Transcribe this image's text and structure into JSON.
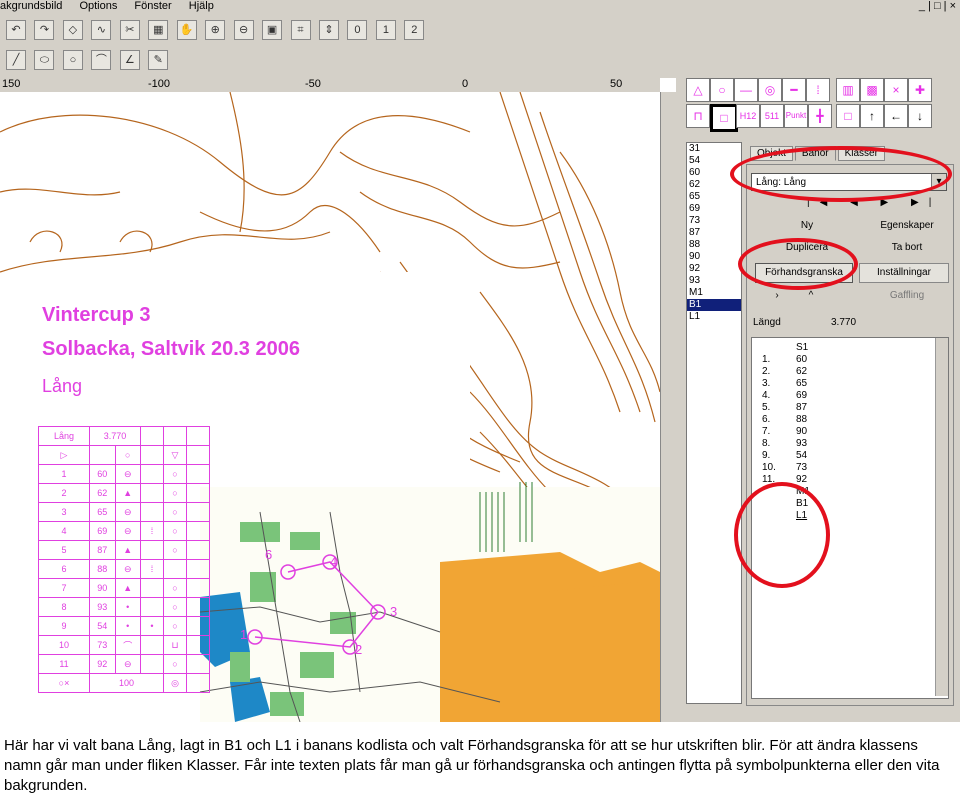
{
  "menu": {
    "items": [
      "akgrundsbild",
      "Options",
      "Fönster",
      "Hjälp"
    ],
    "window_controls": "_ | □ | ×"
  },
  "toolbar": {
    "row1_icons": [
      "undo-icon",
      "redo-icon",
      "diamond-icon",
      "curve-icon",
      "scissors-icon",
      "grid-icon",
      "hand-icon",
      "zoom-in-icon",
      "zoom-out-icon",
      "zoom-box-icon",
      "crosshair-icon",
      "move-icon"
    ],
    "row1_labels": [
      "0",
      "1",
      "2"
    ],
    "row2_icons": [
      "line-icon",
      "ellipse-icon",
      "circle-icon",
      "arc-icon",
      "angle-icon",
      "pen-icon"
    ]
  },
  "ruler": {
    "labels": [
      "150",
      "-100",
      "-50",
      "0",
      "50"
    ]
  },
  "map": {
    "title_line1": "Vintercup 3",
    "title_line2": "Solbacka, Saltvik 20.3 2006",
    "course": "Lång",
    "legend_header": [
      "Lång",
      "3.770"
    ],
    "legend_rows": [
      [
        "1",
        "60"
      ],
      [
        "2",
        "62"
      ],
      [
        "3",
        "65"
      ],
      [
        "4",
        "69"
      ],
      [
        "5",
        "87"
      ],
      [
        "6",
        "88"
      ],
      [
        "7",
        "90"
      ],
      [
        "8",
        "93"
      ],
      [
        "9",
        "54"
      ],
      [
        "10",
        "73"
      ],
      [
        "11",
        "92"
      ]
    ],
    "legend_footer": "100",
    "map_labels": [
      "6",
      "4",
      "3",
      "2",
      "1"
    ]
  },
  "symbols": {
    "row1": [
      "△",
      "○",
      "—",
      "◎",
      "━",
      "⁞",
      "▥",
      "▩",
      "×",
      "✚"
    ],
    "row2": [
      "⊓",
      "□",
      "H12",
      "511",
      "Punkt",
      "╋",
      "□",
      "↑",
      "←",
      "↓"
    ]
  },
  "code_list": [
    "31",
    "54",
    "60",
    "62",
    "65",
    "69",
    "73",
    "87",
    "88",
    "90",
    "92",
    "93",
    "M1",
    "B1",
    "L1"
  ],
  "code_list_selected": "B1",
  "tabs": [
    "Objekt",
    "Banor",
    "Klasser"
  ],
  "active_tab": "Banor",
  "panel": {
    "course_select": "Lång: Lång",
    "nav": "|◀ ◀ ▶ ▶|",
    "btn_new": "Ny",
    "btn_properties": "Egenskaper",
    "btn_duplicate": "Duplicera",
    "btn_delete": "Ta bort",
    "btn_preview": "Förhandsgranska",
    "btn_settings": "Inställningar",
    "btn_cut": "Gaffling",
    "length_label": "Längd",
    "length_value": "3.770",
    "controls": [
      {
        "num": "",
        "code": "S1"
      },
      {
        "num": "1.",
        "code": "60"
      },
      {
        "num": "2.",
        "code": "62"
      },
      {
        "num": "3.",
        "code": "65"
      },
      {
        "num": "4.",
        "code": "69"
      },
      {
        "num": "5.",
        "code": "87"
      },
      {
        "num": "6.",
        "code": "88"
      },
      {
        "num": "7.",
        "code": "90"
      },
      {
        "num": "8.",
        "code": "93"
      },
      {
        "num": "9.",
        "code": "54"
      },
      {
        "num": "10.",
        "code": "73"
      },
      {
        "num": "11.",
        "code": "92"
      },
      {
        "num": "",
        "code": "M1"
      },
      {
        "num": "",
        "code": "B1"
      },
      {
        "num": "",
        "code": "L1"
      }
    ]
  },
  "caption": "Här har vi valt bana Lång, lagt in B1 och L1 i banans kodlista och valt Förhandsgranska för att se hur utskriften blir. För att ändra klassens namn går man under fliken Klasser. Får inte texten plats får man gå ur förhandsgranska och antingen flytta på symbolpunkterna eller den vita bakgrunden.",
  "colors": {
    "highlight": "#e3101d",
    "magenta": "#e040e0",
    "orange": "#f1a534",
    "contour": "#b5651d",
    "selection": "#10207a"
  }
}
